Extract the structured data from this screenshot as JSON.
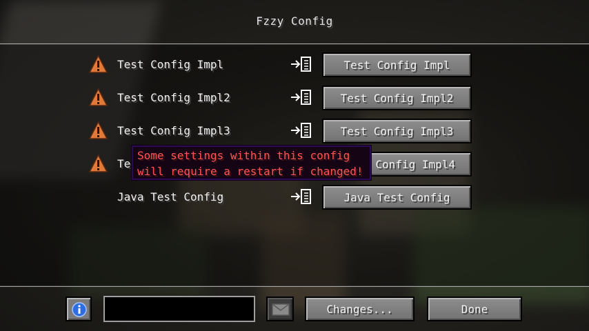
{
  "window": {
    "title": "Fzzy Config"
  },
  "configs": [
    {
      "label": "Test Config Impl",
      "button_label": "Test Config Impl",
      "requires_restart": true
    },
    {
      "label": "Test Config Impl2",
      "button_label": "Test Config Impl2",
      "requires_restart": true
    },
    {
      "label": "Test Config Impl3",
      "button_label": "Test Config Impl3",
      "requires_restart": true
    },
    {
      "label": "Te",
      "button_label": "Config Impl4",
      "requires_restart": true
    },
    {
      "label": "Java Test Config",
      "button_label": "Java Test Config",
      "requires_restart": false
    }
  ],
  "tooltip": {
    "lines": [
      "Some settings within this config",
      "will require a restart if changed!"
    ]
  },
  "footer": {
    "search_value": "",
    "changes_label": "Changes...",
    "done_label": "Done"
  },
  "icons": {
    "warning": "warning-triangle-icon",
    "goto": "go-to-config-icon",
    "info": "info-icon",
    "mail": "mail-icon"
  },
  "colors": {
    "warning_orange": "#e07a3a",
    "tooltip_text": "#ff5555",
    "tooltip_border": "#2a0b57",
    "info_blue": "#2d6de0"
  }
}
